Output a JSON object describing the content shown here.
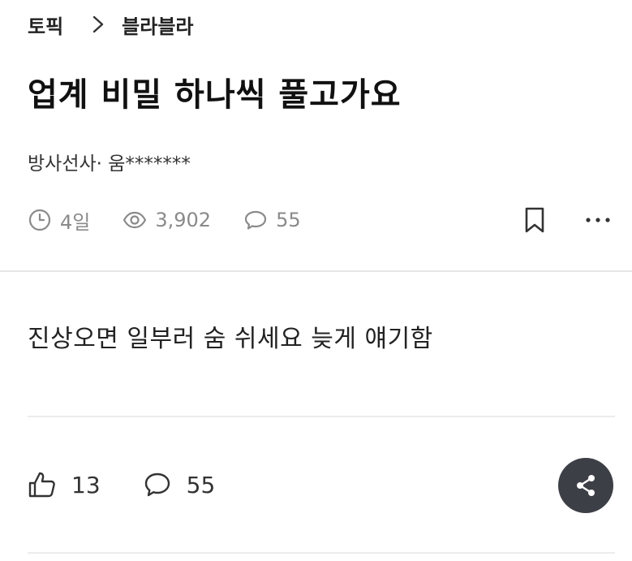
{
  "breadcrumb": {
    "topic": "토픽",
    "category": "블라블라"
  },
  "post": {
    "title": "업계 비밀 하나씩 풀고가요",
    "author": "방사선사· 움*******",
    "time": "4일",
    "views": "3,902",
    "comments": "55",
    "body": "진상오면 일부러 숨 쉬세요 늦게 얘기함"
  },
  "footer": {
    "likes": "13",
    "comments": "55"
  },
  "icons": {
    "chevron": "chevron-right-icon",
    "clock": "clock-icon",
    "eye": "eye-icon",
    "comment": "speech-bubble-icon",
    "bookmark": "bookmark-icon",
    "more": "more-horizontal-icon",
    "like": "thumbs-up-icon",
    "share": "share-icon"
  },
  "colors": {
    "meta_gray": "#8a8a8a",
    "share_bg": "#3d3f46",
    "text": "#222222"
  }
}
